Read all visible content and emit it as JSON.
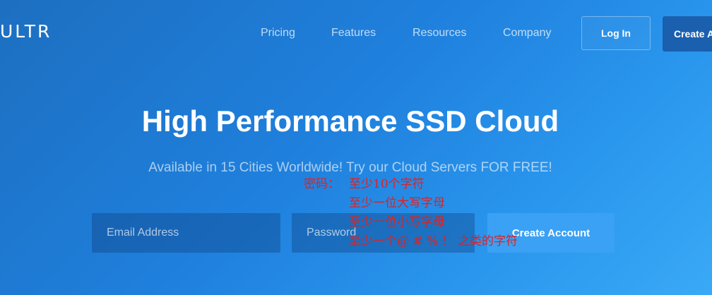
{
  "header": {
    "logo_text": "ULTR",
    "nav": {
      "pricing": "Pricing",
      "features": "Features",
      "resources": "Resources",
      "company": "Company"
    },
    "login_label": "Log In",
    "create_label": "Create Account"
  },
  "hero": {
    "title": "High Performance SSD Cloud",
    "subtitle": "Available in 15 Cities Worldwide! Try our Cloud Servers FOR FREE!"
  },
  "signup_form": {
    "email_placeholder": "Email Address",
    "password_placeholder": "Password",
    "submit_label": "Create Account"
  },
  "annotation": {
    "color": "#e02020",
    "label": "密码：",
    "lines": [
      "至少10个字符",
      "至少一位大写字母",
      "至少一位小写字母",
      "至少一个@ # % ！ 之类的字符"
    ]
  }
}
